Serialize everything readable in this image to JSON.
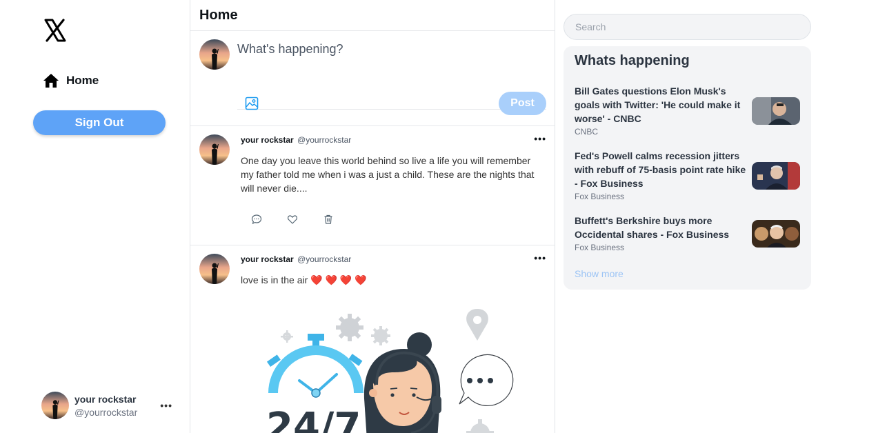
{
  "nav": {
    "home_label": "Home",
    "signout_label": "Sign Out"
  },
  "current_user": {
    "name": "your rockstar",
    "handle": "@yourrockstar"
  },
  "feed": {
    "title": "Home",
    "compose": {
      "placeholder": "What's happening?",
      "post_label": "Post"
    },
    "tweets": [
      {
        "name": "your rockstar",
        "handle": "@yourrockstar",
        "text": "One day you leave this world behind so live a life you will remember my father told me when i was a just a child. These are the nights that will never die...."
      },
      {
        "name": "your rockstar",
        "handle": "@yourrockstar",
        "text": "love is in the air ❤️ ❤️ ❤️ ❤️",
        "image_text": "24/7"
      }
    ]
  },
  "sidebar": {
    "search_placeholder": "Search",
    "trends_title": "Whats happening",
    "news": [
      {
        "title": "Bill Gates questions Elon Musk's goals with Twitter: 'He could make it worse' - CNBC",
        "source": "CNBC"
      },
      {
        "title": "Fed's Powell calms recession jitters with rebuff of 75-basis point rate hike - Fox Business",
        "source": "Fox Business"
      },
      {
        "title": "Buffett's Berkshire buys more Occidental shares - Fox Business",
        "source": "Fox Business"
      }
    ],
    "show_more": "Show more"
  },
  "colors": {
    "accent": "#5ea3f7",
    "post_disabled": "#a9cffb",
    "panel_bg": "#f3f4f6",
    "heart": "#e0245e"
  }
}
